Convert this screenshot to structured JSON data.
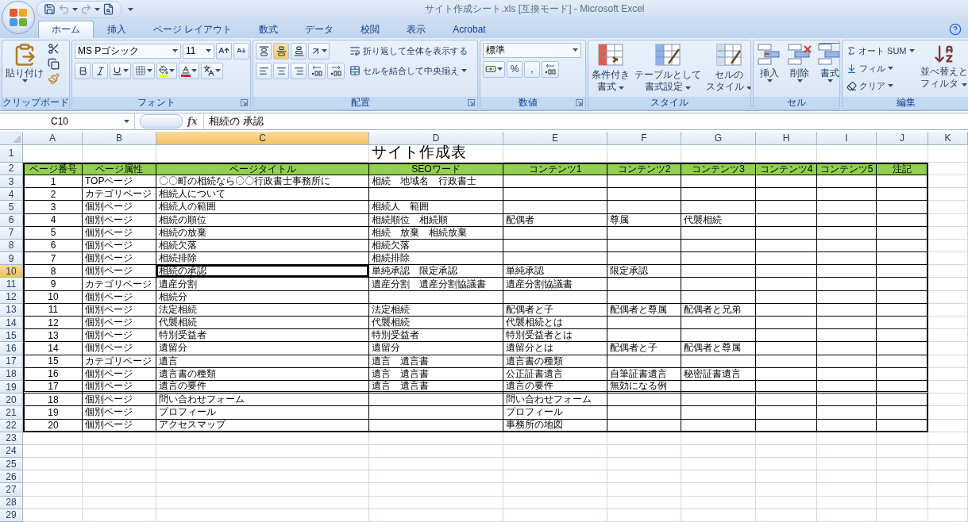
{
  "window": {
    "title": "サイト作成シート.xls  [互換モード] - Microsoft Excel"
  },
  "ribbon_tabs": [
    {
      "label": "ホーム",
      "selected": true
    },
    {
      "label": "挿入",
      "selected": false
    },
    {
      "label": "ページ レイアウト",
      "selected": false
    },
    {
      "label": "数式",
      "selected": false
    },
    {
      "label": "データ",
      "selected": false
    },
    {
      "label": "校閲",
      "selected": false
    },
    {
      "label": "表示",
      "selected": false
    },
    {
      "label": "Acrobat",
      "selected": false
    }
  ],
  "clipboard": {
    "paste": "貼り付け",
    "label": "クリップボード"
  },
  "font": {
    "name": "MS Pゴシック",
    "size": "11",
    "label": "フォント"
  },
  "alignment": {
    "vertical": [
      {
        "selected": false
      },
      {
        "selected": true
      },
      {
        "selected": false
      }
    ],
    "wrap": "折り返して全体を表示する",
    "merge": "セルを結合して中央揃え",
    "label": "配置"
  },
  "number": {
    "format": "標準",
    "percent": "%",
    "comma": ",",
    "label": "数値"
  },
  "styles": {
    "buttons": [
      [
        "条件付き",
        "書式"
      ],
      [
        "テーブルとして",
        "書式設定"
      ],
      [
        "セルの",
        "スタイル"
      ]
    ],
    "label": "スタイル"
  },
  "cells": {
    "buttons": [
      "挿入",
      "削除",
      "書式"
    ],
    "label": "セル"
  },
  "editing": {
    "autosum": "オート SUM",
    "fill": "フィル",
    "clear": "クリア",
    "sort": [
      "並べ替えと",
      "フィルタ"
    ],
    "label": "編集"
  },
  "formula_bar": {
    "name_box": "C10",
    "fx": "fx",
    "value": "相続の 承認"
  },
  "sheet": {
    "columns": [
      {
        "label": "A",
        "selected": false
      },
      {
        "label": "B",
        "selected": false
      },
      {
        "label": "C",
        "selected": true
      },
      {
        "label": "D",
        "selected": false
      },
      {
        "label": "E",
        "selected": false
      },
      {
        "label": "F",
        "selected": false
      },
      {
        "label": "G",
        "selected": false
      },
      {
        "label": "H",
        "selected": false
      },
      {
        "label": "I",
        "selected": false
      },
      {
        "label": "J",
        "selected": false
      },
      {
        "label": "K",
        "selected": false
      }
    ],
    "row_numbers": [
      {
        "label": "1",
        "selected": false
      },
      {
        "label": "2",
        "selected": false
      },
      {
        "label": "3",
        "selected": false
      },
      {
        "label": "4",
        "selected": false
      },
      {
        "label": "5",
        "selected": false
      },
      {
        "label": "6",
        "selected": false
      },
      {
        "label": "7",
        "selected": false
      },
      {
        "label": "8",
        "selected": false
      },
      {
        "label": "9",
        "selected": false
      },
      {
        "label": "10",
        "selected": true
      },
      {
        "label": "11",
        "selected": false
      },
      {
        "label": "12",
        "selected": false
      },
      {
        "label": "13",
        "selected": false
      },
      {
        "label": "14",
        "selected": false
      },
      {
        "label": "15",
        "selected": false
      },
      {
        "label": "16",
        "selected": false
      },
      {
        "label": "17",
        "selected": false
      },
      {
        "label": "18",
        "selected": false
      },
      {
        "label": "19",
        "selected": false
      },
      {
        "label": "20",
        "selected": false
      },
      {
        "label": "21",
        "selected": false
      },
      {
        "label": "22",
        "selected": false
      },
      {
        "label": "23",
        "selected": false
      },
      {
        "label": "24",
        "selected": false
      },
      {
        "label": "25",
        "selected": false
      },
      {
        "label": "26",
        "selected": false
      },
      {
        "label": "27",
        "selected": false
      },
      {
        "label": "28",
        "selected": false
      },
      {
        "label": "29",
        "selected": false
      }
    ],
    "title": "サイト作成表",
    "headers": [
      "ページ番号",
      "ページ属性",
      "ページタイトル",
      "SEOワード",
      "コンテンツ1",
      "コンテンツ2",
      "コンテンツ3",
      "コンテンツ4",
      "コンテンツ5",
      "注記"
    ],
    "rows": [
      {
        "no": "1",
        "type": "TOPページ",
        "title": "〇〇町の相続なら〇〇行政書士事務所に",
        "seo": "相続　地域名　行政書士",
        "contents": [],
        "double_line_below": false
      },
      {
        "no": "2",
        "type": "カテゴリページ",
        "title": "相続人について",
        "contents": [],
        "double_line_below": false
      },
      {
        "no": "3",
        "type": "個別ページ",
        "title": "相続人の範囲",
        "seo": "相続人　範囲",
        "contents": [],
        "double_line_below": false
      },
      {
        "no": "4",
        "type": "個別ページ",
        "title": "相続の順位",
        "seo": "相続順位　相続順",
        "contents": [
          "配偶者",
          "尊属",
          "代襲相続"
        ],
        "double_line_below": false
      },
      {
        "no": "5",
        "type": "個別ページ",
        "title": "相続の放棄",
        "seo": "相続　放棄　相続放棄",
        "contents": [],
        "double_line_below": false
      },
      {
        "no": "6",
        "type": "個別ページ",
        "title": "相続欠落",
        "seo": "相続欠落",
        "contents": [],
        "double_line_below": false
      },
      {
        "no": "7",
        "type": "個別ページ",
        "title": "相続排除",
        "seo": "相続排除",
        "contents": [],
        "double_line_below": false
      },
      {
        "no": "8",
        "type": "個別ページ",
        "title": "相続の承認",
        "seo": "単純承認　限定承認",
        "contents": [
          "単純承認",
          "限定承認"
        ],
        "double_line_below": false
      },
      {
        "no": "9",
        "type": "カテゴリページ",
        "title": "遺産分割",
        "seo": "遺産分割　遺産分割協議書",
        "contents": [
          "遺産分割協議書"
        ],
        "double_line_below": false
      },
      {
        "no": "10",
        "type": "個別ページ",
        "title": "相続分",
        "contents": [],
        "double_line_below": false
      },
      {
        "no": "11",
        "type": "個別ページ",
        "title": "法定相続",
        "seo": "法定相続",
        "contents": [
          "配偶者と子",
          "配偶者と尊属",
          "配偶者と兄弟"
        ],
        "double_line_below": false
      },
      {
        "no": "12",
        "type": "個別ページ",
        "title": "代襲相続",
        "seo": "代襲相続",
        "contents": [
          "代襲相続とは"
        ],
        "double_line_below": false
      },
      {
        "no": "13",
        "type": "個別ページ",
        "title": "特別受益者",
        "seo": "特別受益者",
        "contents": [
          "特別受益者とは"
        ],
        "double_line_below": false
      },
      {
        "no": "14",
        "type": "個別ページ",
        "title": "遺留分",
        "seo": "遺留分",
        "contents": [
          "遺留分とは",
          "配偶者と子",
          "配偶者と尊属"
        ],
        "double_line_below": false
      },
      {
        "no": "15",
        "type": "カテゴリページ",
        "title": "遺言",
        "seo": "遺言　遺言書",
        "contents": [
          "遺言書の種類"
        ],
        "double_line_below": false
      },
      {
        "no": "16",
        "type": "個別ページ",
        "title": "遺言書の種類",
        "seo": "遺言　遺言書",
        "contents": [
          "公正証書遺言",
          "自筆証書遺言",
          "秘密証書遺言"
        ],
        "double_line_below": false
      },
      {
        "no": "17",
        "type": "個別ページ",
        "title": "遺言の要件",
        "seo": "遺言　遺言書",
        "contents": [
          "遺言の要件",
          "無効になる例"
        ],
        "double_line_below": true
      },
      {
        "no": "18",
        "type": "個別ページ",
        "title": "問い合わせフォーム",
        "contents": [
          "問い合わせフォーム"
        ],
        "double_line_below": false
      },
      {
        "no": "19",
        "type": "個別ページ",
        "title": "プロフィール",
        "contents": [
          "プロフィール"
        ],
        "double_line_below": false
      },
      {
        "no": "20",
        "type": "個別ページ",
        "title": "アクセスマップ",
        "contents": [
          "事務所の地図"
        ],
        "double_line_below": false
      }
    ]
  }
}
